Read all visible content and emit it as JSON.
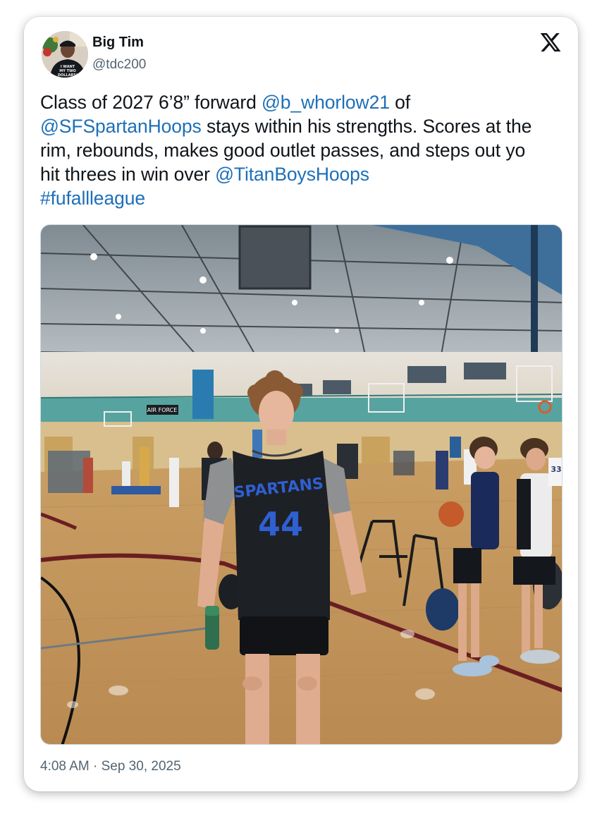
{
  "author": {
    "name": "Big Tim",
    "handle": "@tdc200",
    "avatar_shirt_text": "I WANT MY TWO DOLLARS!"
  },
  "tweet": {
    "segments": [
      {
        "text": "Class of 2027 6’8” forward ",
        "link": false
      },
      {
        "text": "@b_whorlow21",
        "link": true
      },
      {
        "text": " of ",
        "link": false
      },
      {
        "text": "@SFSpartanHoops",
        "link": true
      },
      {
        "text": " stays within his strengths. Scores at the rim, rebounds, makes good outlet passes, and steps out yo hit threes in win over ",
        "link": false
      },
      {
        "text": "@TitanBoysHoops",
        "link": true
      },
      {
        "text": " ",
        "link": false
      },
      {
        "text": "#fufallleague",
        "link": true
      }
    ]
  },
  "photo": {
    "jersey_team": "SPARTANS",
    "jersey_number": "44",
    "banner_text": "AIR FORCE",
    "side_player_number": "33"
  },
  "timestamp": "4:08 AM · Sep 30, 2025",
  "colors": {
    "link": "#1d6fb8",
    "text": "#0f1419",
    "muted": "#536471",
    "jersey": "#1d2024",
    "jersey_lettering": "#2f5fd0"
  },
  "icons": {
    "brand": "x-logo-icon"
  }
}
